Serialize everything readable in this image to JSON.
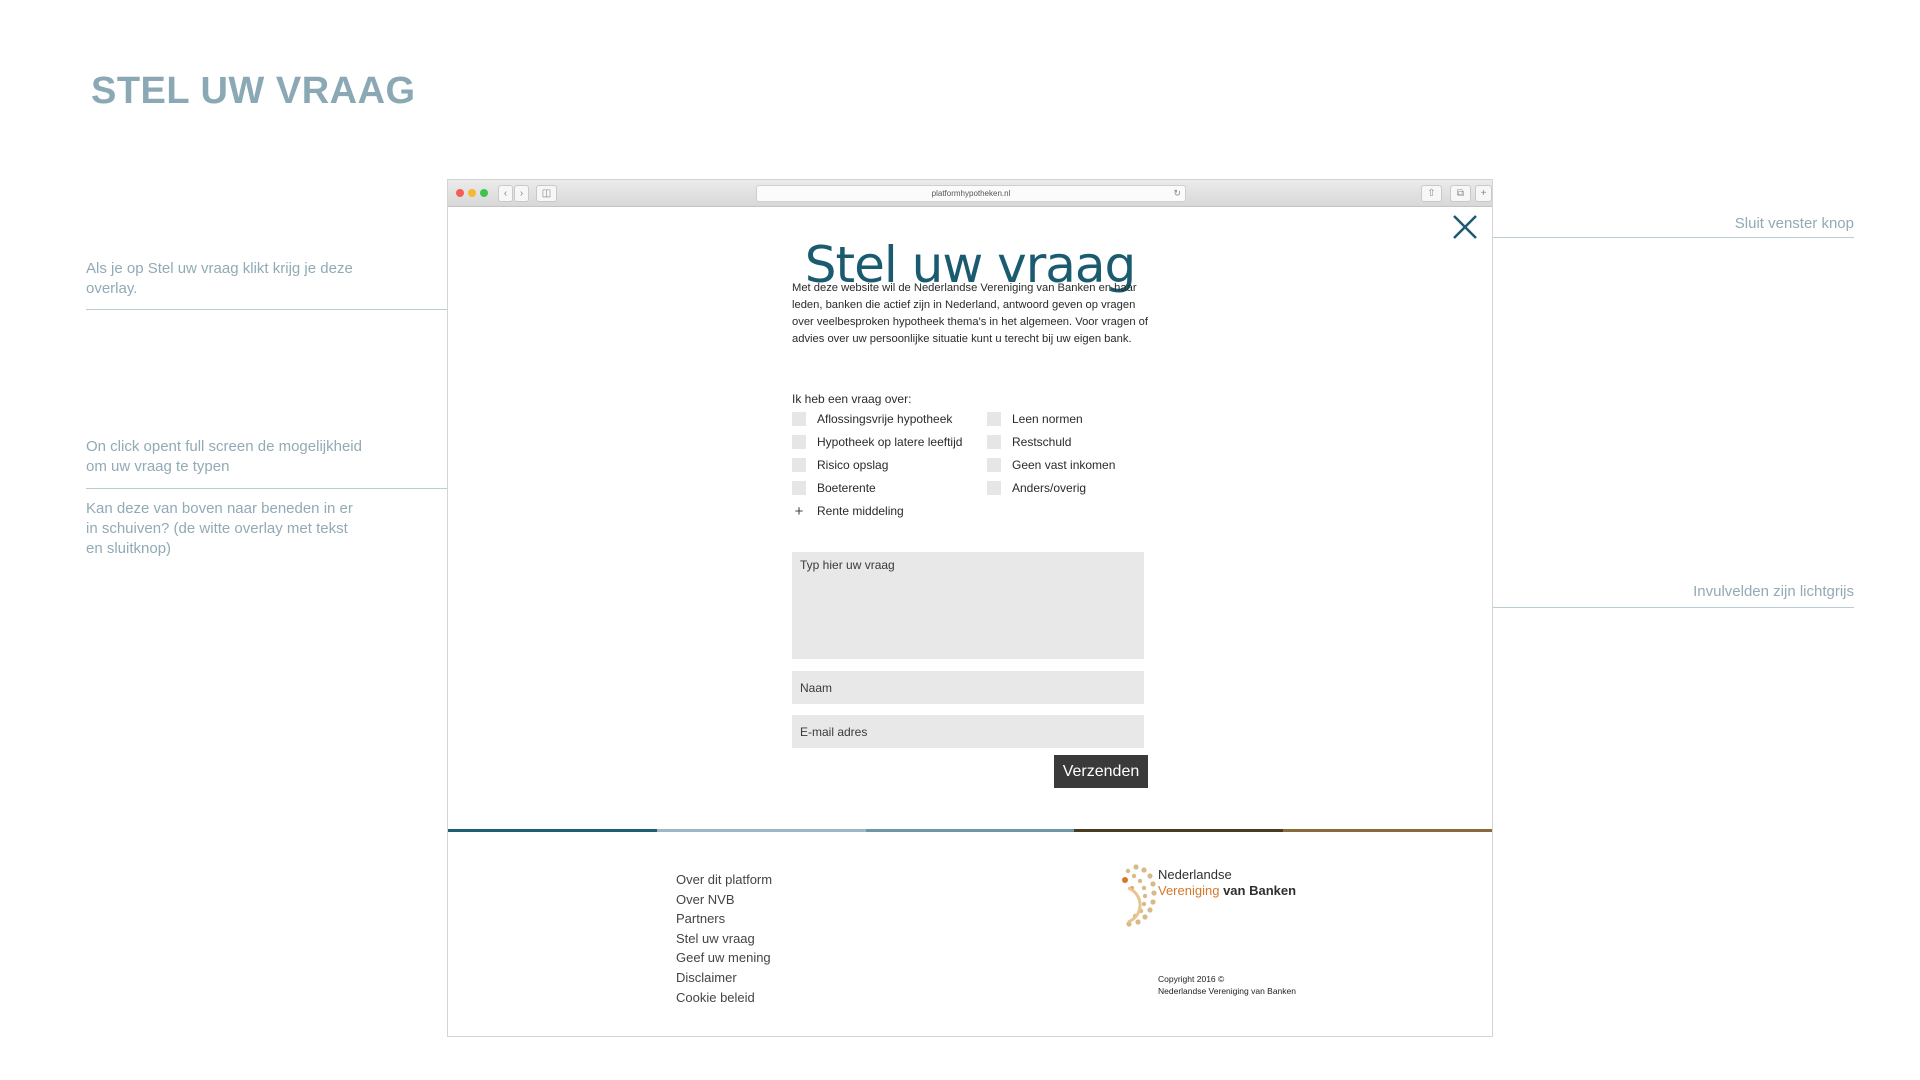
{
  "page_title": "STEL UW VRAAG",
  "annotations": {
    "overlay_note": "Als je op Stel uw vraag klikt krijg je deze overlay.",
    "fullscreen_note": "On click opent full screen de mogelijkheid om uw vraag te typen",
    "slide_note": "Kan deze van boven naar beneden in er in schuiven? (de witte overlay met tekst en sluitknop)",
    "close_note": "Sluit venster knop",
    "fields_note": "Invulvelden zijn lichtgrijs"
  },
  "browser": {
    "url": "platformhypotheken.nl"
  },
  "modal": {
    "title": "Stel uw vraag",
    "intro": "Met deze website wil de Nederlandse Vereniging van Banken en haar leden, banken die actief zijn in Nederland, antwoord geven op vragen over veelbesproken hypotheek thema's in het algemeen. Voor vragen of advies over uw persoonlijke situatie kunt u terecht bij uw eigen bank.",
    "question_label": "Ik heb een vraag over:",
    "topics_left": [
      "Aflossingsvrije hypotheek",
      "Hypotheek op latere leeftijd",
      "Risico opslag",
      "Boeterente"
    ],
    "topics_right": [
      "Leen normen",
      "Restschuld",
      "Geen vast inkomen",
      "Anders/overig"
    ],
    "extra_topic": "Rente middeling",
    "question_placeholder": "Typ hier uw vraag",
    "name_placeholder": "Naam",
    "email_placeholder": "E-mail adres",
    "submit_label": "Verzenden"
  },
  "footer": {
    "links": [
      "Over dit platform",
      "Over NVB",
      "Partners",
      "Stel uw vraag",
      "Geef uw mening",
      "Disclaimer",
      "Cookie beleid"
    ],
    "logo_line1": "Nederlandse",
    "logo_line2a": "Vereniging",
    "logo_line2b": "van Banken",
    "copyright_line1": "Copyright 2016 ©",
    "copyright_line2": "Nederlandse Vereniging van Banken"
  },
  "colors": {
    "title_blue": "#1a5b70",
    "annotation": "#92aab5",
    "field_grey": "#e8e8e8",
    "button_dark": "#3a3a3a",
    "logo_orange": "#d4782a",
    "band": [
      "#1e5f73",
      "#9bb9c4",
      "#6e97a6",
      "#4a3a1e",
      "#8a6a3a"
    ]
  }
}
